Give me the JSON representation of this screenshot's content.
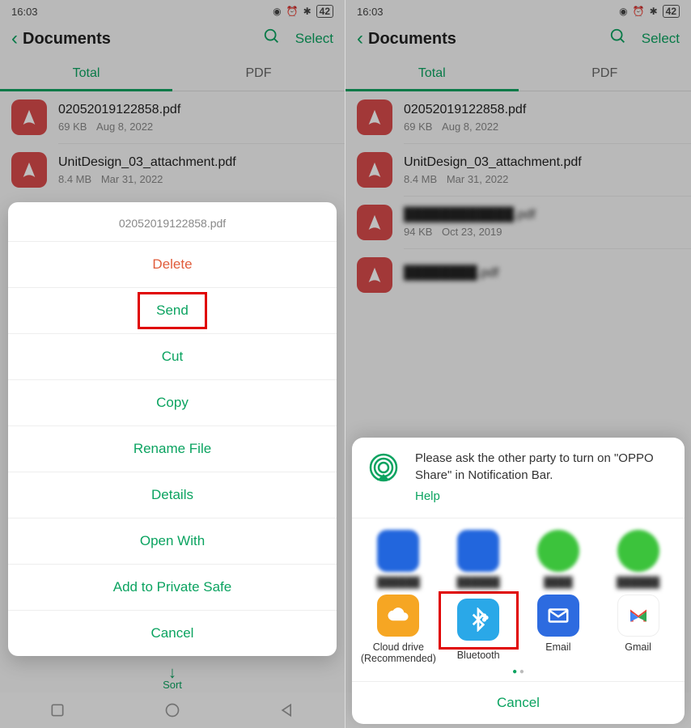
{
  "status": {
    "time": "16:03",
    "battery": "42"
  },
  "header": {
    "title": "Documents",
    "select": "Select"
  },
  "tabs": {
    "total": "Total",
    "pdf": "PDF"
  },
  "files": {
    "f1": {
      "name": "02052019122858.pdf",
      "size": "69 KB",
      "date": "Aug 8, 2022"
    },
    "f2": {
      "name": "UnitDesign_03_attachment.pdf",
      "size": "8.4 MB",
      "date": "Mar 31, 2022"
    },
    "f3": {
      "name": "████████████.pdf",
      "size": "94 KB",
      "date": "Oct 23, 2019"
    },
    "f4": {
      "name": "████████.pdf"
    }
  },
  "menu": {
    "title": "02052019122858.pdf",
    "delete": "Delete",
    "send": "Send",
    "cut": "Cut",
    "copy": "Copy",
    "rename": "Rename File",
    "details": "Details",
    "open": "Open With",
    "safe": "Add to Private Safe",
    "cancel": "Cancel"
  },
  "share": {
    "prompt": "Please ask the other party to turn on \"OPPO Share\" in Notification Bar.",
    "help": "Help",
    "apps": {
      "cloud": "Cloud drive (Recommended)",
      "bluetooth": "Bluetooth",
      "email": "Email",
      "gmail": "Gmail"
    },
    "cancel": "Cancel"
  },
  "sort": "Sort"
}
